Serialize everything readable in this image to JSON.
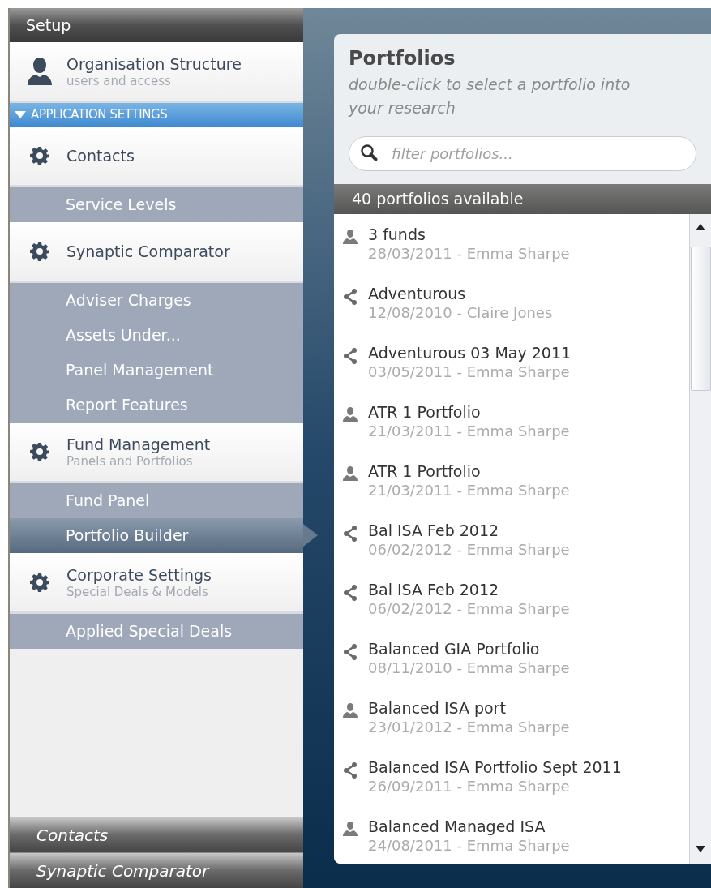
{
  "sidebar": {
    "header": "Setup",
    "items": [
      {
        "kind": "profile",
        "title": "Organisation Structure",
        "subtitle": "users and access"
      },
      {
        "kind": "group_header",
        "title": "APPLICATION SETTINGS",
        "expanded": true
      },
      {
        "kind": "section",
        "title": "Contacts"
      },
      {
        "kind": "subitem",
        "title": "Service Levels",
        "selected": false
      },
      {
        "kind": "section",
        "title": "Synaptic Comparator"
      },
      {
        "kind": "subitem",
        "title": "Adviser Charges",
        "selected": false
      },
      {
        "kind": "subitem",
        "title": "Assets Under...",
        "selected": false
      },
      {
        "kind": "subitem",
        "title": "Panel Management",
        "selected": false
      },
      {
        "kind": "subitem",
        "title": "Report Features",
        "selected": false
      },
      {
        "kind": "section",
        "title": "Fund Management",
        "subtitle": "Panels and Portfolios"
      },
      {
        "kind": "subitem",
        "title": "Fund Panel",
        "selected": false
      },
      {
        "kind": "subitem",
        "title": "Portfolio Builder",
        "selected": true
      },
      {
        "kind": "section",
        "title": "Corporate Settings",
        "subtitle": "Special Deals & Models"
      },
      {
        "kind": "subitem",
        "title": "Applied Special Deals",
        "selected": false
      }
    ],
    "footer_tabs": [
      "Contacts",
      "Synaptic Comparator"
    ]
  },
  "panel": {
    "title": "Portfolios",
    "subtitle": "double-click to select a portfolio into your research",
    "search": {
      "placeholder": "filter portfolios..."
    },
    "count": "40 portfolios available",
    "portfolios": [
      {
        "kind": "personal",
        "name": "3 funds",
        "detail": "28/03/2011 - Emma Sharpe"
      },
      {
        "kind": "shared",
        "name": "Adventurous",
        "detail": "12/08/2010 - Claire Jones"
      },
      {
        "kind": "shared",
        "name": "Adventurous 03 May 2011",
        "detail": "03/05/2011 - Emma Sharpe"
      },
      {
        "kind": "personal",
        "name": "ATR 1 Portfolio",
        "detail": "21/03/2011 - Emma Sharpe"
      },
      {
        "kind": "personal",
        "name": "ATR 1 Portfolio",
        "detail": "21/03/2011 - Emma Sharpe"
      },
      {
        "kind": "shared",
        "name": "Bal ISA Feb 2012",
        "detail": "06/02/2012 - Emma Sharpe"
      },
      {
        "kind": "shared",
        "name": "Bal ISA Feb 2012",
        "detail": "06/02/2012 - Emma Sharpe"
      },
      {
        "kind": "shared",
        "name": "Balanced GIA Portfolio",
        "detail": "08/11/2010 - Emma Sharpe"
      },
      {
        "kind": "personal",
        "name": "Balanced ISA port",
        "detail": "23/01/2012 - Emma Sharpe"
      },
      {
        "kind": "shared",
        "name": "Balanced ISA Portfolio Sept 2011",
        "detail": "26/09/2011 - Emma Sharpe"
      },
      {
        "kind": "personal",
        "name": "Balanced Managed ISA",
        "detail": "24/08/2011 - Emma Sharpe"
      }
    ]
  }
}
